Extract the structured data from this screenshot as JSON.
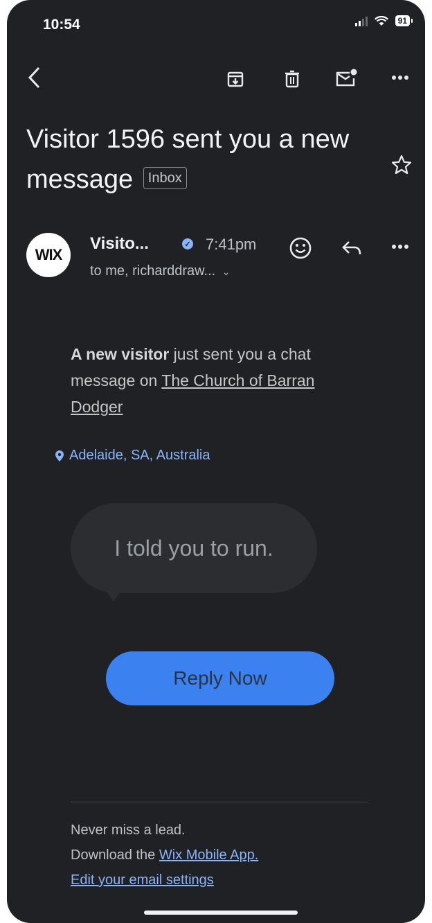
{
  "status_bar": {
    "time": "10:54",
    "battery": "91"
  },
  "toolbar": {
    "back_icon": "chevron-left-icon",
    "archive_icon": "archive-icon",
    "delete_icon": "trash-icon",
    "mark_unread_icon": "mail-unread-icon",
    "more_icon": "more-horizontal-icon"
  },
  "email": {
    "subject": "Visitor 1596 sent you a new message",
    "label": "Inbox",
    "sender_avatar_text": "WIX",
    "sender_name": "Visito...",
    "time": "7:41pm",
    "recipients": "to me, richarddraw...",
    "body": {
      "intro_bold": "A new visitor",
      "intro_rest": " just sent you a chat message on ",
      "site_link": "The Church of Barran Dodger"
    },
    "location": "Adelaide, SA, Australia",
    "chat_message": "I told you to run.",
    "reply_button": "Reply Now",
    "footer": {
      "line1": "Never miss a lead.",
      "line2_prefix": "Download the ",
      "line2_link": "Wix Mobile App.",
      "line3_link": "Edit your email settings"
    }
  },
  "colors": {
    "background": "#202124",
    "accent": "#3b82f0",
    "link": "#8ab4f8"
  }
}
